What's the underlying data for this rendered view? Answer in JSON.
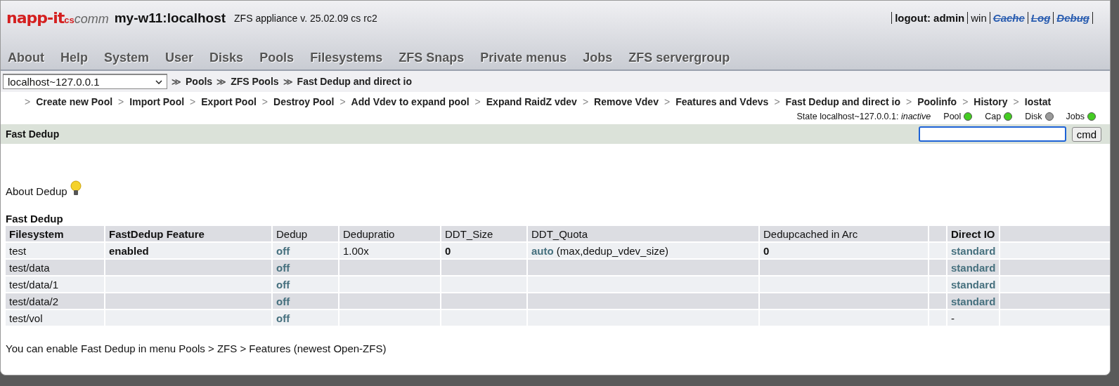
{
  "logo": {
    "main": "napp-it",
    "sub": "cs",
    "tail": "comm"
  },
  "host_title": "my-w11:localhost",
  "version": "ZFS appliance v. 25.02.09 cs rc2",
  "top_links": [
    {
      "label": "logout: admin",
      "kind": "bold"
    },
    {
      "label": "win",
      "kind": "plain"
    },
    {
      "label": "Cache",
      "kind": "struck"
    },
    {
      "label": "Log",
      "kind": "struck"
    },
    {
      "label": "Debug",
      "kind": "struck"
    }
  ],
  "nav": [
    "About",
    "Help",
    "System",
    "User",
    "Disks",
    "Pools",
    "Filesystems",
    "ZFS Snaps",
    "Private menus",
    "Jobs",
    "ZFS servergroup"
  ],
  "host_select": {
    "value": "localhost~127.0.0.1"
  },
  "breadcrumb_separator": "≫",
  "breadcrumb": [
    "Pools",
    "ZFS Pools",
    "Fast Dedup and direct io"
  ],
  "submenu_separator": ">",
  "submenu": [
    "Create new Pool",
    "Import Pool",
    "Export Pool",
    "Destroy Pool",
    "Add Vdev to expand pool",
    "Expand RaidZ vdev",
    "Remove Vdev",
    "Features and Vdevs",
    "Fast Dedup and direct io",
    "Poolinfo",
    "History",
    "Iostat"
  ],
  "state": {
    "label": "State localhost~127.0.0.1:",
    "value": "inactive",
    "indicators": [
      {
        "label": "Pool",
        "color": "#44cc22"
      },
      {
        "label": "Cap",
        "color": "#44cc22"
      },
      {
        "label": "Disk",
        "color": "#9a9a9a"
      },
      {
        "label": "Jobs",
        "color": "#44cc22"
      }
    ]
  },
  "section": {
    "title": "Fast Dedup",
    "cmd_button": "cmd"
  },
  "about": {
    "label": "About Dedup"
  },
  "table": {
    "title": "Fast Dedup",
    "columns": [
      {
        "label": "Filesystem",
        "bold": true,
        "gap_before": false
      },
      {
        "label": "FastDedup Feature",
        "bold": true,
        "gap_before": false
      },
      {
        "label": "Dedup",
        "bold": false,
        "gap_before": false
      },
      {
        "label": "Dedupratio",
        "bold": false,
        "gap_before": false
      },
      {
        "label": "DDT_Size",
        "bold": false,
        "gap_before": false
      },
      {
        "label": "DDT_Quota",
        "bold": false,
        "gap_before": false
      },
      {
        "label": "Dedupcached in Arc",
        "bold": false,
        "gap_before": false
      },
      {
        "label": "Direct IO",
        "bold": true,
        "gap_before": true
      }
    ],
    "rows": [
      {
        "cells": [
          {
            "text": "test",
            "kind": "plain"
          },
          {
            "text": "enabled",
            "kind": "bold"
          },
          {
            "text": "off",
            "kind": "link"
          },
          {
            "text": "1.00x",
            "kind": "plain"
          },
          {
            "text": "0",
            "kind": "bold"
          },
          {
            "text": "auto",
            "kind": "link",
            "note": "(max,dedup_vdev_size)"
          },
          {
            "text": "0",
            "kind": "bold"
          },
          {
            "text": "standard",
            "kind": "link"
          }
        ]
      },
      {
        "cells": [
          {
            "text": "test/data",
            "kind": "plain"
          },
          null,
          {
            "text": "off",
            "kind": "link"
          },
          null,
          null,
          null,
          null,
          {
            "text": "standard",
            "kind": "link"
          }
        ]
      },
      {
        "cells": [
          {
            "text": "test/data/1",
            "kind": "plain"
          },
          null,
          {
            "text": "off",
            "kind": "link"
          },
          null,
          null,
          null,
          null,
          {
            "text": "standard",
            "kind": "link"
          }
        ]
      },
      {
        "cells": [
          {
            "text": "test/data/2",
            "kind": "plain"
          },
          null,
          {
            "text": "off",
            "kind": "link"
          },
          null,
          null,
          null,
          null,
          {
            "text": "standard",
            "kind": "link"
          }
        ]
      },
      {
        "cells": [
          {
            "text": "test/vol",
            "kind": "plain"
          },
          null,
          {
            "text": "off",
            "kind": "link"
          },
          null,
          null,
          null,
          null,
          {
            "text": "-",
            "kind": "plain"
          }
        ]
      }
    ]
  },
  "footnote": "You can enable Fast Dedup in menu Pools > ZFS > Features (newest Open-ZFS)"
}
